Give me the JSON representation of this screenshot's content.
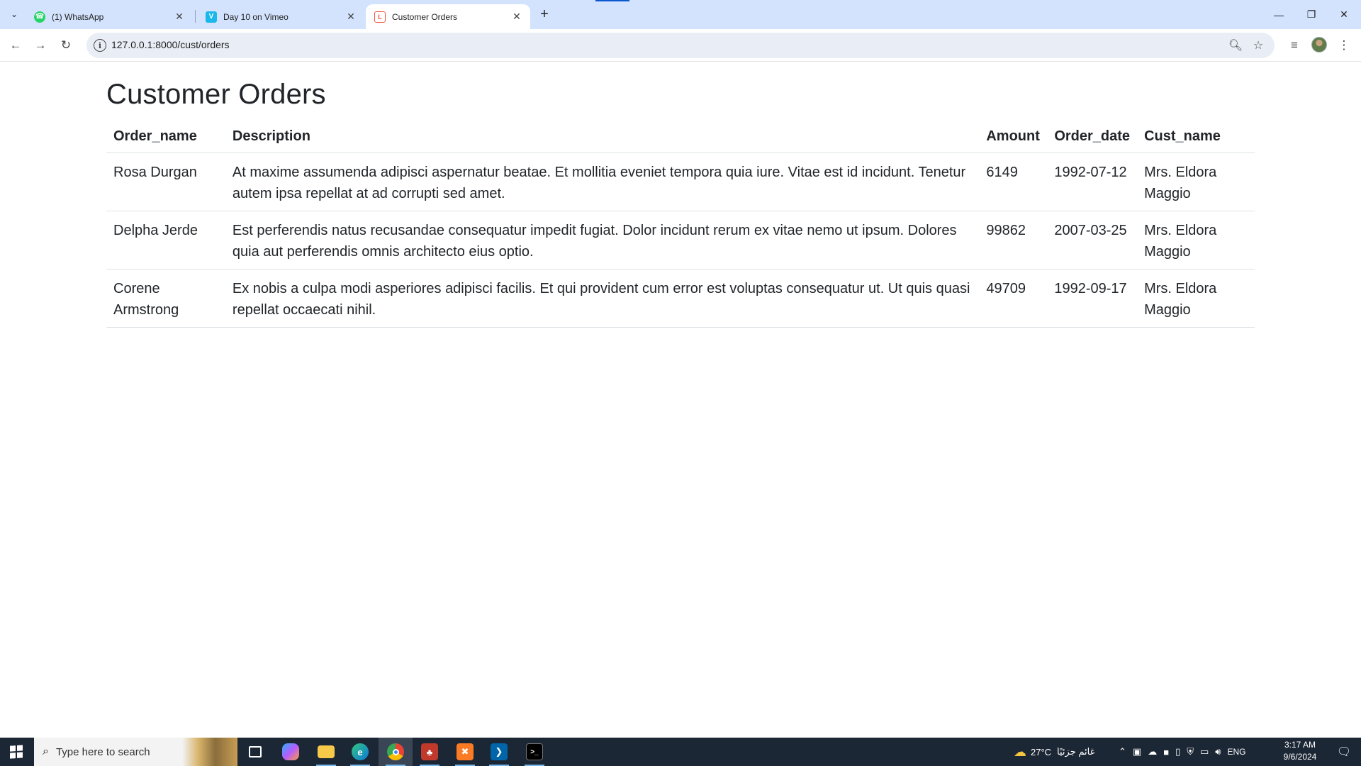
{
  "browser": {
    "tabs": [
      {
        "title": "(1) WhatsApp",
        "favicon": "whatsapp-icon",
        "active": false
      },
      {
        "title": "Day 10 on Vimeo",
        "favicon": "vimeo-icon",
        "active": false
      },
      {
        "title": "Customer Orders",
        "favicon": "laravel-icon",
        "active": true
      }
    ],
    "url": "127.0.0.1:8000/cust/orders"
  },
  "page": {
    "title": "Customer Orders",
    "table": {
      "headers": [
        "Order_name",
        "Description",
        "Amount",
        "Order_date",
        "Cust_name"
      ],
      "rows": [
        [
          "Rosa Durgan",
          "At maxime assumenda adipisci aspernatur beatae. Et mollitia eveniet tempora quia iure. Vitae est id incidunt. Tenetur autem ipsa repellat at ad corrupti sed amet.",
          "6149",
          "1992-07-12",
          "Mrs. Eldora Maggio"
        ],
        [
          "Delpha Jerde",
          "Est perferendis natus recusandae consequatur impedit fugiat. Dolor incidunt rerum ex vitae nemo ut ipsum. Dolores quia aut perferendis omnis architecto eius optio.",
          "99862",
          "2007-03-25",
          "Mrs. Eldora Maggio"
        ],
        [
          "Corene Armstrong",
          "Ex nobis a culpa modi asperiores adipisci facilis. Et qui provident cum error est voluptas consequatur ut. Ut quis quasi repellat occaecati nihil.",
          "49709",
          "1992-09-17",
          "Mrs. Eldora Maggio"
        ]
      ]
    }
  },
  "taskbar": {
    "search_placeholder": "Type here to search",
    "weather": "27°C",
    "weather_text": "غائم جزئيًا",
    "language": "ENG",
    "time": "3:17 AM",
    "date": "9/6/2024"
  },
  "colors": {
    "tabstrip": "#d3e3fd",
    "omnibox": "#e9eef6",
    "taskbar": "#1c2736",
    "text": "#212529"
  }
}
